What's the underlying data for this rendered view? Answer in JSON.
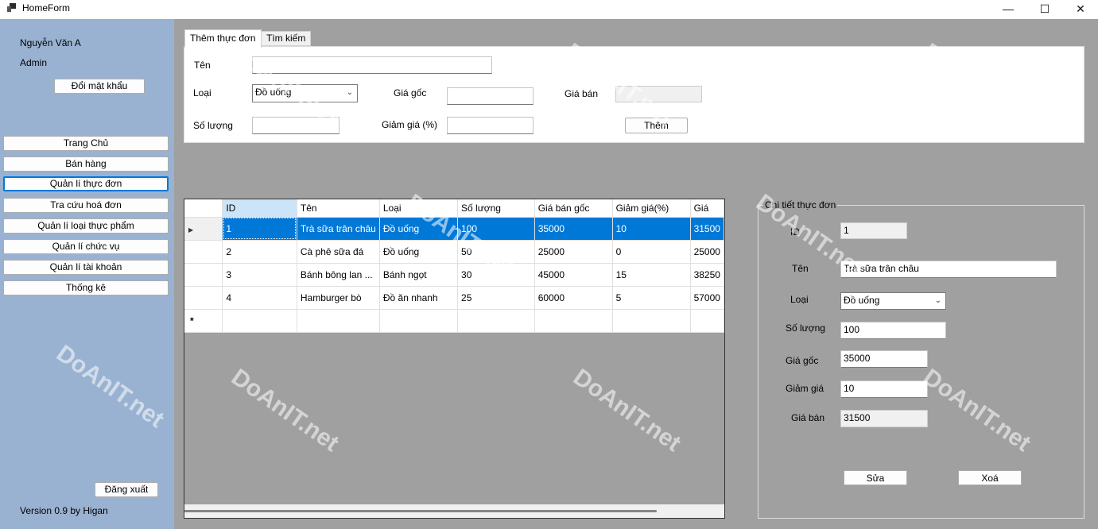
{
  "window": {
    "title": "HomeForm",
    "minimize_glyph": "—",
    "maximize_glyph": "☐",
    "close_glyph": "✕"
  },
  "sidebar": {
    "user_name": "Nguyễn Văn A",
    "user_role": "Admin",
    "change_password": "Đổi mật khẩu",
    "menu": [
      {
        "label": "Trang Chủ"
      },
      {
        "label": "Bán hàng"
      },
      {
        "label": "Quản lí thực đơn",
        "active": true
      },
      {
        "label": "Tra cứu hoá đơn"
      },
      {
        "label": "Quản lí loại thực phẩm"
      },
      {
        "label": "Quản lí chức vụ"
      },
      {
        "label": "Quản lí tài khoản"
      },
      {
        "label": "Thống kê"
      }
    ],
    "logout": "Đăng xuất",
    "version": "Version 0.9 by Higan"
  },
  "tabs": [
    {
      "label": "Thêm thực đơn",
      "active": true
    },
    {
      "label": "Tìm kiếm",
      "active": false
    }
  ],
  "add_form": {
    "name_label": "Tên",
    "name_value": "",
    "type_label": "Loại",
    "type_value": "Đồ uống",
    "cost_label": "Giá gốc",
    "cost_value": "",
    "price_label": "Giá bán",
    "price_value": "",
    "qty_label": "Số lượng",
    "qty_value": "",
    "discount_label": "Giảm giá (%)",
    "discount_value": "",
    "add_button": "Thêm"
  },
  "grid": {
    "columns": [
      "ID",
      "Tên",
      "Loại",
      "Số lượng",
      "Giá bán gốc",
      "Giảm giá(%)",
      "Giá"
    ],
    "rows": [
      [
        "1",
        "Trà sữa trân châu",
        "Đồ uống",
        "100",
        "35000",
        "10",
        "31500"
      ],
      [
        "2",
        "Cà phê sữa đá",
        "Đồ uống",
        "50",
        "25000",
        "0",
        "25000"
      ],
      [
        "3",
        "Bánh bông lan ...",
        "Bánh ngọt",
        "30",
        "45000",
        "15",
        "38250"
      ],
      [
        "4",
        "Hamburger bò",
        "Đồ ăn nhanh",
        "25",
        "60000",
        "5",
        "57000"
      ]
    ],
    "selected_row": 0,
    "current_row_marker": "▶",
    "new_row_marker": "*"
  },
  "detail": {
    "title": "Chi tiết thực đơn",
    "id_label": "ID",
    "id_value": "1",
    "name_label": "Tên",
    "name_value": "Trà sữa trân châu",
    "type_label": "Loại",
    "type_value": "Đồ uống",
    "qty_label": "Số lượng",
    "qty_value": "100",
    "cost_label": "Giá gốc",
    "cost_value": "35000",
    "discount_label": "Giảm giá",
    "discount_value": "10",
    "price_label": "Giá bán",
    "price_value": "31500",
    "edit_button": "Sửa",
    "delete_button": "Xoá"
  },
  "watermark": "DoAnIT.net"
}
